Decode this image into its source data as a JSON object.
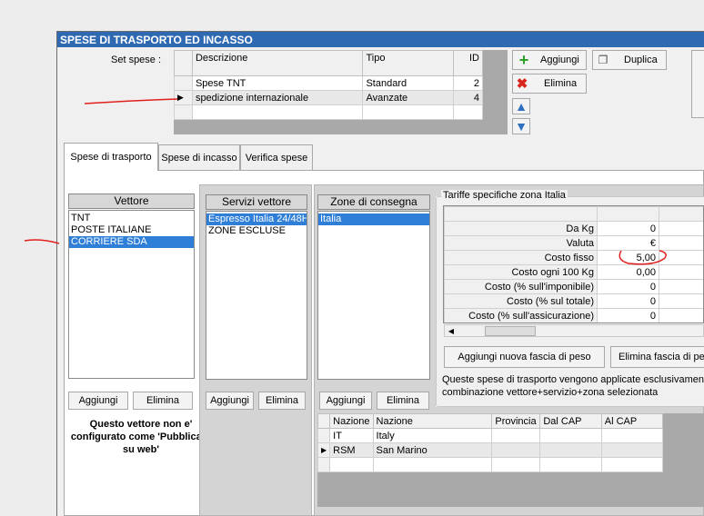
{
  "window": {
    "title": "SPESE DI TRASPORTO ED INCASSO"
  },
  "set_spese": {
    "label": "Set spese :",
    "columns": [
      "Descrizione",
      "Tipo",
      "ID"
    ],
    "rows": [
      {
        "descrizione": "Spese TNT",
        "tipo": "Standard",
        "id": "2"
      },
      {
        "descrizione": "spedizione internazionale",
        "tipo": "Avanzate",
        "id": "4"
      }
    ]
  },
  "toolbar": {
    "aggiungi": "Aggiungi",
    "duplica": "Duplica",
    "elimina": "Elimina"
  },
  "tabs": [
    "Spese di trasporto",
    "Spese di incasso",
    "Verifica spese"
  ],
  "vettore": {
    "header": "Vettore",
    "items": [
      "TNT",
      "POSTE ITALIANE",
      "CORRIERE SDA"
    ],
    "add": "Aggiungi",
    "remove": "Elimina",
    "note": "Questo vettore non e' configurato come 'Pubblicato su web'"
  },
  "servizi": {
    "header": "Servizi vettore",
    "items": [
      "Espresso Italia 24/48H",
      "ZONE ESCLUSE"
    ],
    "add": "Aggiungi",
    "remove": "Elimina"
  },
  "zone": {
    "header": "Zone di consegna",
    "items": [
      "Italia"
    ],
    "add": "Aggiungi",
    "remove": "Elimina"
  },
  "tariffe": {
    "legend": "Tariffe specifiche zona Italia",
    "rows": [
      {
        "label": "Da Kg",
        "v1": "0",
        "v2": ""
      },
      {
        "label": "Valuta",
        "v1": "€",
        "v2": ""
      },
      {
        "label": "Costo fisso",
        "v1": "5,00",
        "v2": "5,"
      },
      {
        "label": "Costo ogni 100 Kg",
        "v1": "0,00",
        "v2": "0,"
      },
      {
        "label": "Costo (% sull'imponibile)",
        "v1": "0",
        "v2": ""
      },
      {
        "label": "Costo (% sul totale)",
        "v1": "0",
        "v2": ""
      },
      {
        "label": "Costo (% sull'assicurazione)",
        "v1": "0",
        "v2": ""
      }
    ],
    "add_band": "Aggiungi nuova fascia di peso",
    "remove_band": "Elimina fascia di pes",
    "info": "Queste spese di trasporto vengono applicate esclusivamente",
    "info2": "combinazione vettore+servizio+zona selezionata"
  },
  "nazioni": {
    "columns": [
      "Nazione",
      "Nazione",
      "Provincia",
      "Dal CAP",
      "Al CAP"
    ],
    "rows": [
      {
        "code": "IT",
        "name": "Italy"
      },
      {
        "code": "RSM",
        "name": "San Marino"
      }
    ]
  },
  "colors": {
    "title_bg": "#2f69b2",
    "selection": "#2f7fd9",
    "annotation": "#e0201c"
  }
}
